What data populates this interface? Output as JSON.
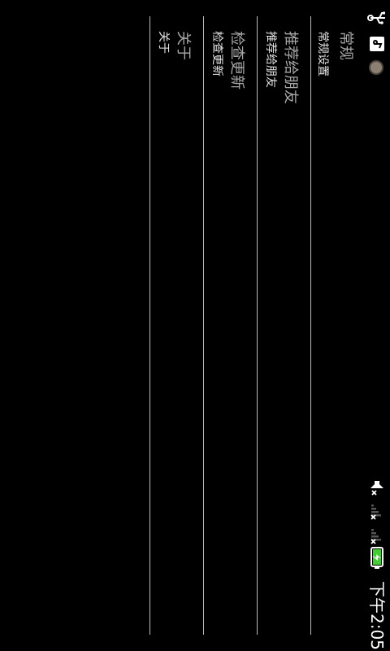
{
  "status_bar": {
    "time": "下午2:05",
    "battery_color": "#3fd12f"
  },
  "settings": [
    {
      "title": "常规",
      "subtitle": "常规设置"
    },
    {
      "title": "推荐给朋友",
      "subtitle": "推荐给朋友"
    },
    {
      "title": "检查更新",
      "subtitle": "检查更新"
    },
    {
      "title": "关于",
      "subtitle": "关于"
    }
  ]
}
